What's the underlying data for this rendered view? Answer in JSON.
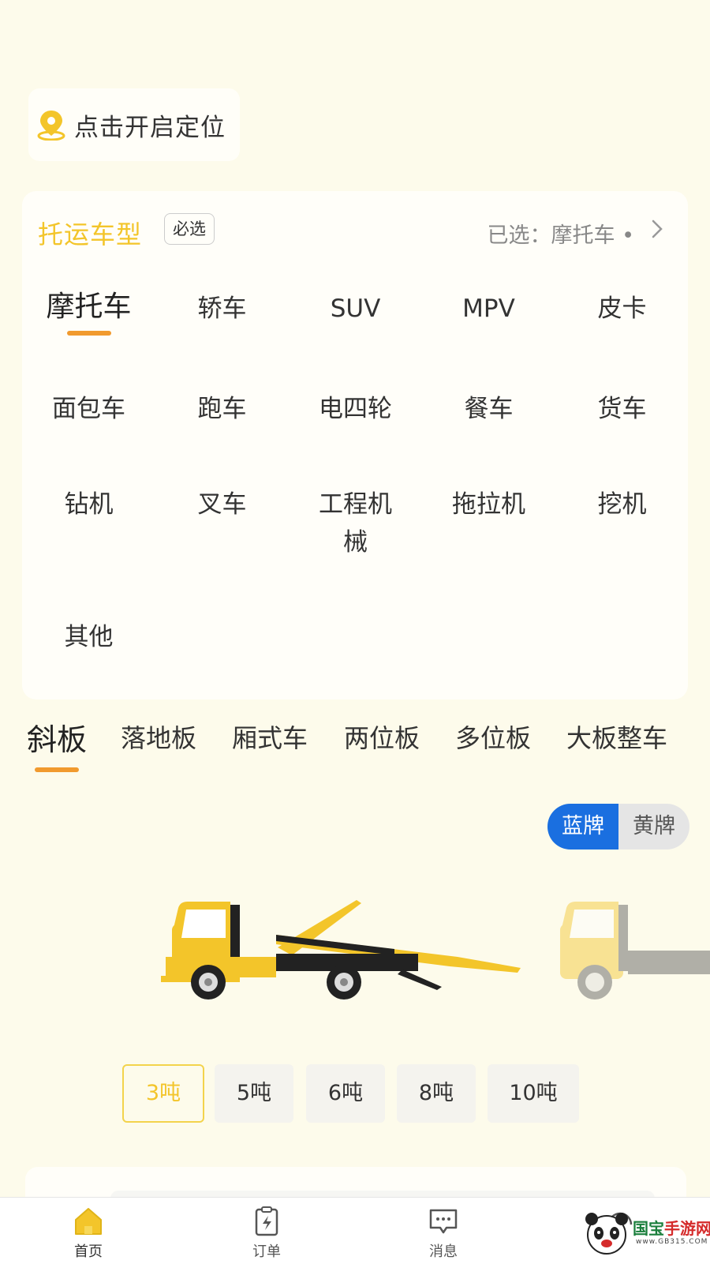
{
  "location": {
    "label": "点击开启定位",
    "icon": "location-pin-icon"
  },
  "vehicle_type": {
    "title": "托运车型",
    "required_tag": "必选",
    "selected_summary": "已选：摩托车 •",
    "items": [
      "摩托车",
      "轿车",
      "SUV",
      "MPV",
      "皮卡",
      "面包车",
      "跑车",
      "电四轮",
      "餐车",
      "货车",
      "钻机",
      "叉车",
      "工程机械",
      "拖拉机",
      "挖机",
      "其他"
    ],
    "selected": "摩托车"
  },
  "truck_types": {
    "items": [
      "斜板",
      "落地板",
      "厢式车",
      "两位板",
      "多位板",
      "大板整车"
    ],
    "selected": "斜板"
  },
  "plate_color": {
    "options": [
      "蓝牌",
      "黄牌"
    ],
    "selected": "蓝牌"
  },
  "tonnage": {
    "options": [
      "3吨",
      "5吨",
      "6吨",
      "8吨",
      "10吨"
    ],
    "selected": "3吨"
  },
  "tabbar": {
    "items": [
      {
        "label": "首页",
        "icon": "home-icon"
      },
      {
        "label": "订单",
        "icon": "order-icon"
      },
      {
        "label": "消息",
        "icon": "message-icon"
      }
    ],
    "active": "首页"
  },
  "watermark": {
    "brand_a": "国宝",
    "brand_b": "手游网",
    "domain": "www.GB315.COM"
  },
  "colors": {
    "accent_yellow": "#f3c52a",
    "accent_orange": "#f19a2e",
    "plate_blue": "#1a6fe0",
    "background": "#fdfbeb"
  }
}
